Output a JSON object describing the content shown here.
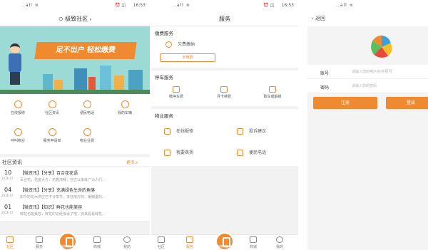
{
  "status": {
    "time": "16:53",
    "signal": "..all ≋",
    "battery": "⏰ ◫"
  },
  "home": {
    "location": "极致社区",
    "banner_slogan": "足不出户  轻松缴费",
    "grid": [
      {
        "label": "在线报修",
        "icon": "wrench-icon"
      },
      {
        "label": "社区资讯",
        "icon": "news-icon"
      },
      {
        "label": "便民电话",
        "icon": "phone-icon"
      },
      {
        "label": "我的车辆",
        "icon": "car-icon"
      },
      {
        "label": "呼叫物业",
        "icon": "call-icon"
      },
      {
        "label": "服务申请单",
        "icon": "form-icon"
      },
      {
        "label": "物业业费",
        "icon": "fee-icon"
      }
    ],
    "news_title": "社区资讯",
    "news_more": "更多>",
    "news": [
      {
        "day": "10",
        "month": "2016-07",
        "title": "【微资讯】【分享】百合花花语",
        "desc": "百合花，花姿大方，花香浓郁，自古以来就广为人们..."
      },
      {
        "day": "04",
        "month": "2016-07",
        "title": "【微资讯】【分享】充满绿色生命的角落",
        "desc": "如今的花木供应已不分季节，来自南方的、暖棚里的..."
      },
      {
        "day": "01",
        "month": "2016-07",
        "title": "【微资讯】【知识】鲜花也能美容",
        "desc": "鲜花也能美容，鲜花印记经惊呆了吧，快来看看鲜花..."
      }
    ],
    "tabs": [
      "社区",
      "服务",
      "呼叫物业",
      "商城",
      "我的"
    ]
  },
  "service": {
    "title": "服务",
    "pay_section": "缴费服务",
    "arrears": "欠费缴纳",
    "pay_button": "去缴费",
    "parking_section": "停车服务",
    "parking": [
      {
        "label": "缴停车费",
        "icon": "parking-icon"
      },
      {
        "label": "月卡续费",
        "icon": "card-icon"
      },
      {
        "label": "取车或解锁",
        "icon": "car-unlock-icon"
      }
    ],
    "property_section": "物业服务",
    "property": [
      {
        "label": "在线报修",
        "icon": "wrench-icon"
      },
      {
        "label": "投诉建议",
        "icon": "chat-icon"
      },
      {
        "label": "我要表扬",
        "icon": "thumb-icon"
      },
      {
        "label": "便民电话",
        "icon": "book-icon"
      }
    ],
    "tabs": [
      "社区",
      "服务",
      "呼叫物业",
      "商城",
      "我的"
    ]
  },
  "login": {
    "back": "返回",
    "account_label": "账号",
    "account_placeholder": "请输入您的用户名/手机号",
    "password_label": "密码",
    "password_placeholder": "请输入您的密码",
    "register": "注册",
    "login": "登录",
    "colors": {
      "accent": "#f08a31"
    }
  }
}
